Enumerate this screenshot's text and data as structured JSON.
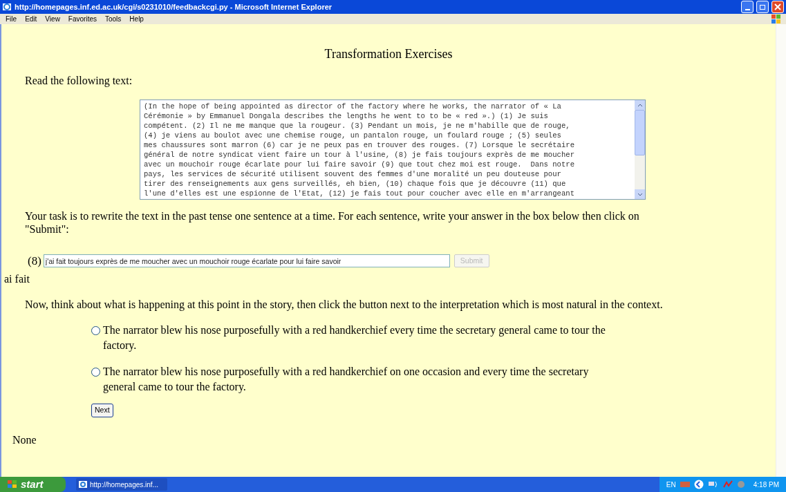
{
  "window": {
    "title": "http://homepages.inf.ed.ac.uk/cgi/s0231010/feedbackcgi.py - Microsoft Internet Explorer"
  },
  "menu": [
    "File",
    "Edit",
    "View",
    "Favorites",
    "Tools",
    "Help"
  ],
  "page": {
    "heading": "Transformation Exercises",
    "intro": "Read the following text:",
    "text_lines": [
      "(In the hope of being appointed as director of the factory where he works, the narrator of « La",
      "Cérémonie » by Emmanuel Dongala describes the lengths he went to to be « red ».) (1) Je suis",
      "compétent. (2) Il ne me manque que la rougeur. (3) Pendant un mois, je ne m'habille que de rouge,",
      "(4) je viens au boulot avec une chemise rouge, un pantalon rouge, un foulard rouge ; (5) seules",
      "mes chaussures sont marron (6) car je ne peux pas en trouver des rouges. (7) Lorsque le secrétaire",
      "général de notre syndicat vient faire un tour à l'usine, (8) je fais toujours exprès de me moucher",
      "avec un mouchoir rouge écarlate pour lui faire savoir (9) que tout chez moi est rouge.  Dans notre",
      "pays, les services de sécurité utilisent souvent des femmes d'une moralité un peu douteuse pour",
      "tirer des renseignements aux gens surveillés, eh bien, (10) chaque fois que je découvre (11) que",
      "l'une d'elles est une espionne de l'Etat, (12) je fais tout pour coucher avec elle en m'arrangeant"
    ],
    "task": "Your task is to rewrite the text in the past tense one sentence at a time. For each sentence, write your answer in the box below then click on \"Submit\":",
    "sentence_number": "(8)",
    "answer": "j'ai fait toujours exprès de me moucher avec un mouchoir rouge écarlate pour lui faire savoir",
    "submit": {
      "label": "Submit",
      "disabled": true
    },
    "feedback": "ai fait",
    "question": "Now, think about what is happening at this point in the story, then click the button next to the interpretation which is most natural in the context.",
    "options": [
      {
        "label": "The narrator blew his nose purposefully with a red handkerchief every time the secretary general came to tour the factory.",
        "selected": false
      },
      {
        "label": "The narrator blew his nose purposefully with a red handkerchief on one occasion and every time the secretary general came to tour the factory.",
        "selected": false
      }
    ],
    "next": "Next",
    "result": "None"
  },
  "taskbar": {
    "start": "start",
    "task": "http://homepages.inf...",
    "language": "EN",
    "clock": "4:18 PM"
  }
}
